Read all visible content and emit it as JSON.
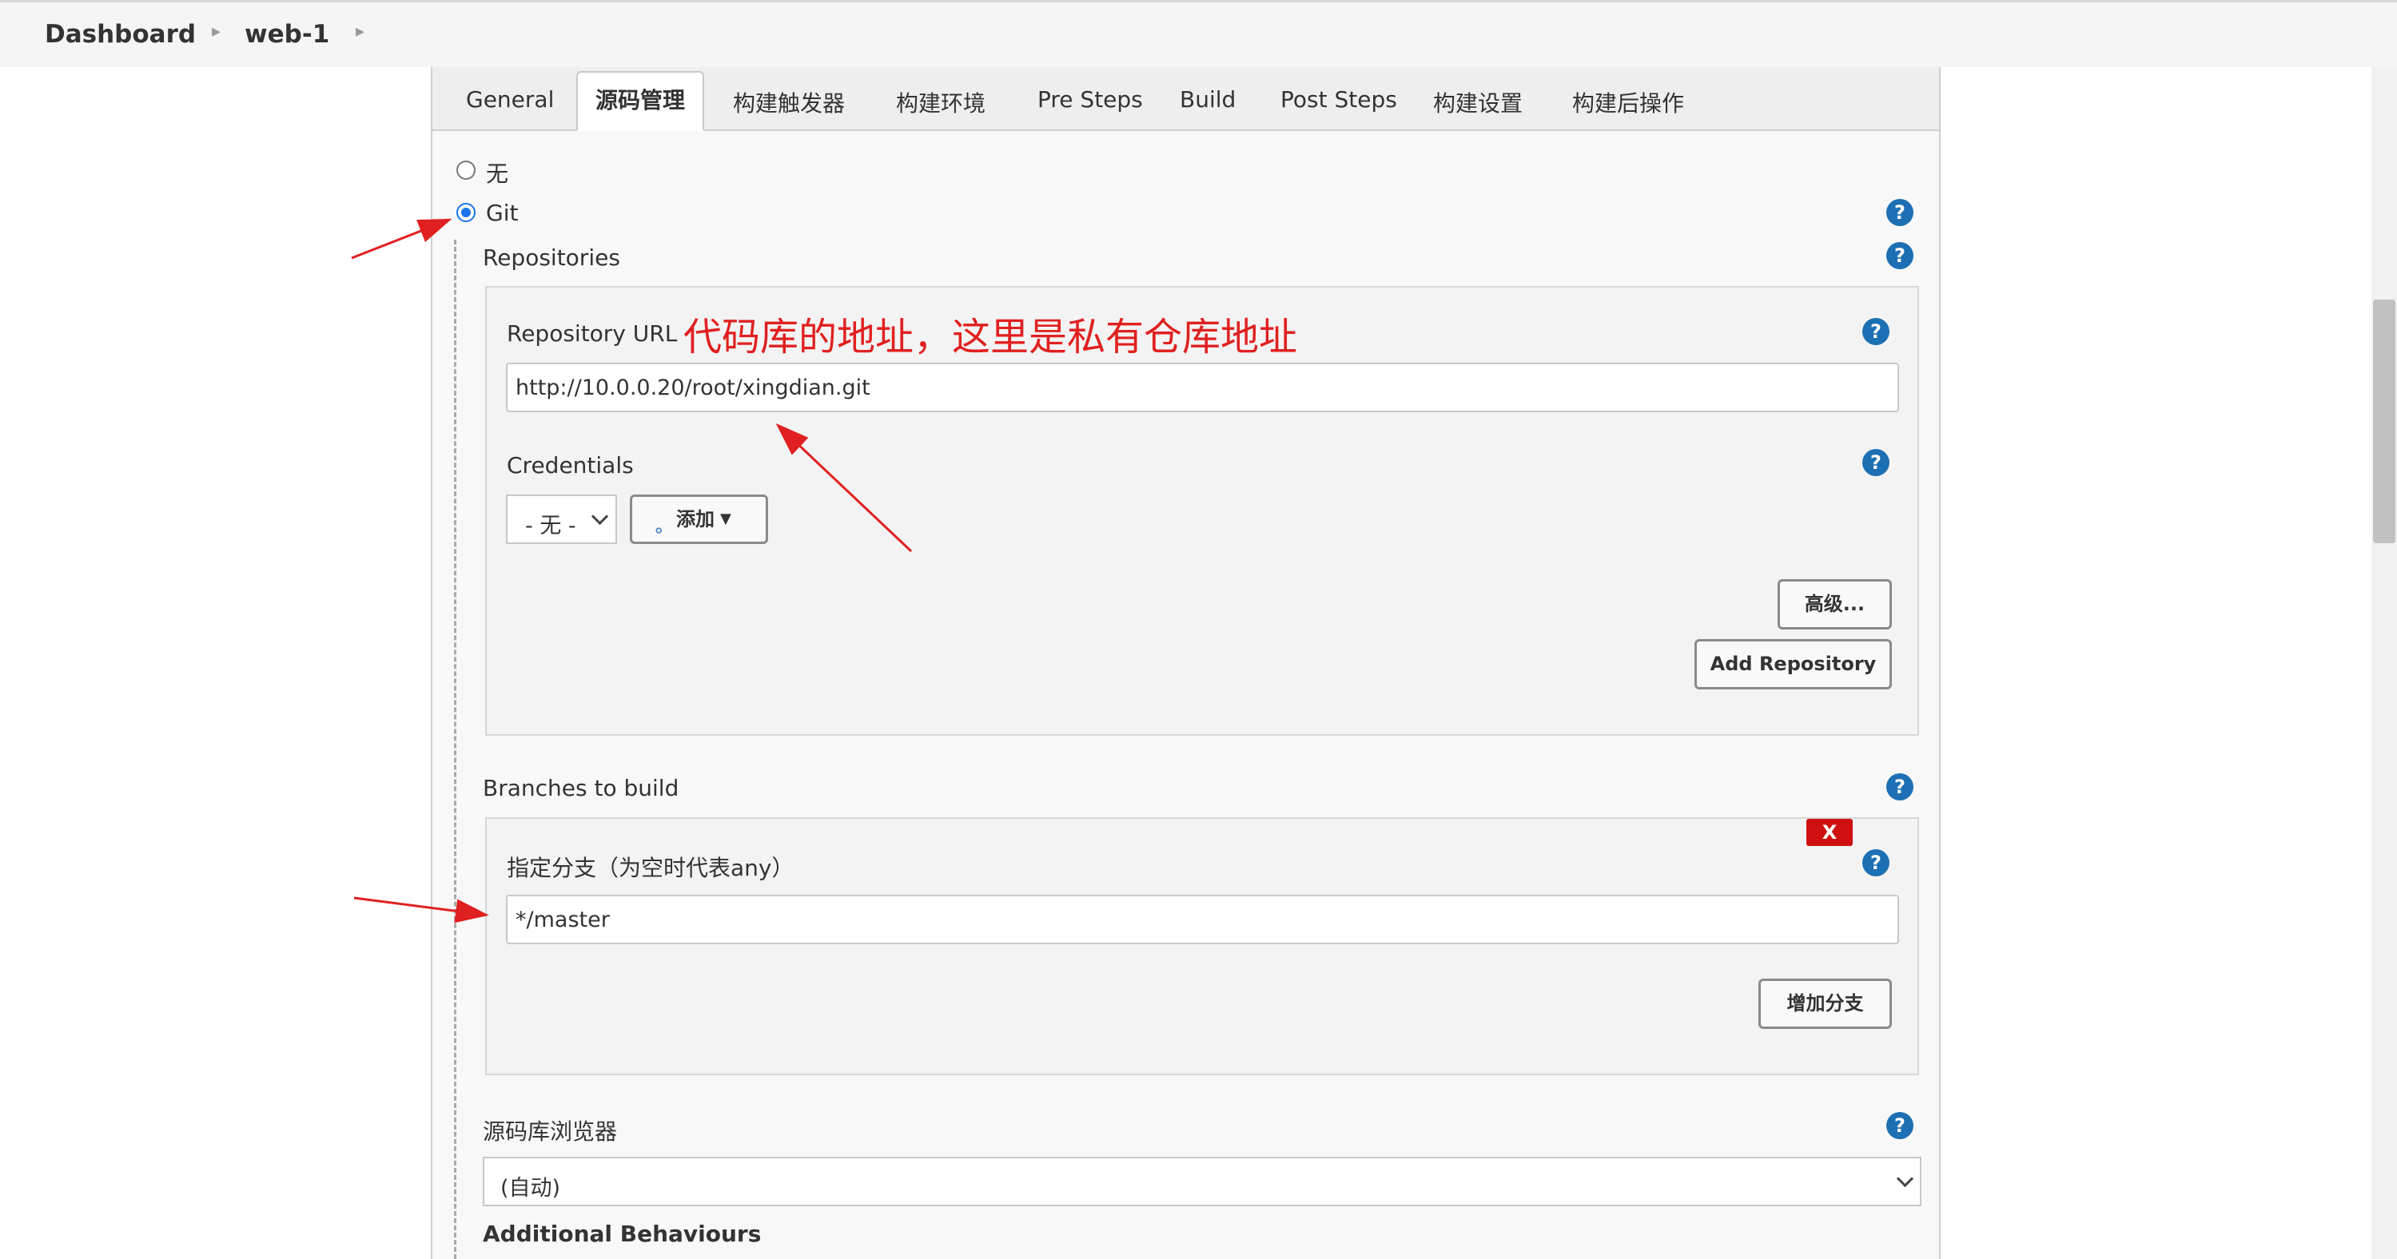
{
  "breadcrumb": {
    "items": [
      "Dashboard",
      "web-1"
    ]
  },
  "tabs": [
    "General",
    "源码管理",
    "构建触发器",
    "构建环境",
    "Pre Steps",
    "Build",
    "Post Steps",
    "构建设置",
    "构建后操作"
  ],
  "active_tab": "源码管理",
  "scm": {
    "option_none": "无",
    "option_git": "Git",
    "selected": "Git",
    "repositories_label": "Repositories",
    "repo_url_label": "Repository URL",
    "repo_url_value": "http://10.0.0.20/root/xingdian.git",
    "credentials_label": "Credentials",
    "credentials_selected": "- 无 -",
    "add_button": "添加",
    "advanced_button": "高级...",
    "add_repository_button": "Add Repository",
    "branches_label": "Branches to build",
    "branch_spec_label": "指定分支（为空时代表any）",
    "branch_spec_value": "*/master",
    "delete_branch_button": "X",
    "add_branch_button": "增加分支",
    "browser_label": "源码库浏览器",
    "browser_selected": "(自动)",
    "additional_behaviours_label": "Additional Behaviours"
  },
  "help_glyph": "?",
  "annotation_text": "代码库的地址，这里是私有仓库地址",
  "colors": {
    "annotation": "#e02020",
    "accent": "#1a73e8",
    "help": "#1d6fb3",
    "delete": "#d01010"
  }
}
